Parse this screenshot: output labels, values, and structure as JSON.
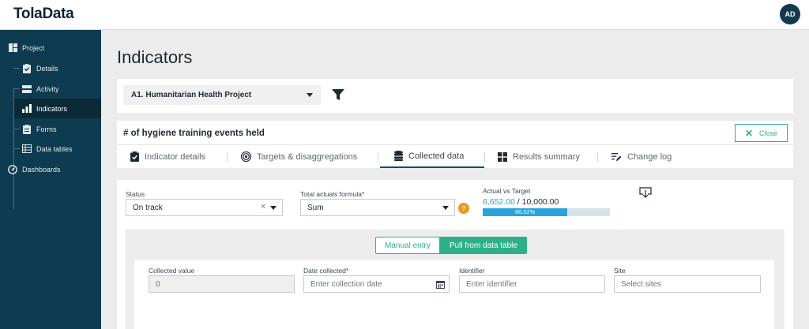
{
  "app": {
    "logo": "TolaData",
    "avatar_initials": "AD"
  },
  "sidebar": {
    "items": [
      {
        "label": "Project",
        "icon": "project-icon"
      },
      {
        "label": "Details",
        "icon": "clipboard-check-icon"
      },
      {
        "label": "Activity",
        "icon": "server-icon"
      },
      {
        "label": "Indicators",
        "icon": "bar-chart-icon",
        "active": true
      },
      {
        "label": "Forms",
        "icon": "clipboard-icon"
      },
      {
        "label": "Data tables",
        "icon": "table-icon"
      },
      {
        "label": "Dashboards",
        "icon": "gauge-icon"
      }
    ]
  },
  "page": {
    "title": "Indicators"
  },
  "project_select": {
    "value": "A1. Humanitarian Health Project",
    "filter_icon": "filter-icon"
  },
  "indicator": {
    "title": "# of hygiene training events held",
    "close_label": "Close",
    "tabs": [
      {
        "label": "Indicator details",
        "icon": "clipboard-check-icon"
      },
      {
        "label": "Targets & disaggregations",
        "icon": "target-icon"
      },
      {
        "label": "Collected data",
        "icon": "database-icon",
        "active": true
      },
      {
        "label": "Results summary",
        "icon": "grid-icon"
      },
      {
        "label": "Change log",
        "icon": "list-edit-icon"
      }
    ]
  },
  "collected": {
    "status_label": "Status",
    "status_value": "On track",
    "formula_label": "Total actuals formula*",
    "formula_value": "Sum",
    "help_glyph": "?",
    "avt_label": "Actual vs Target",
    "actual": "6,652.00",
    "target_text": " / 10,000.00",
    "progress_label": "66.52%",
    "progress_fraction": 0.6652,
    "toggle": {
      "manual": "Manual entry",
      "pull": "Pull from data table"
    },
    "fields": {
      "value_label": "Collected value",
      "value": "0",
      "date_label": "Date collected*",
      "date_placeholder": "Enter collection date",
      "identifier_label": "Identifier",
      "identifier_placeholder": "Enter identifier",
      "site_label": "Site",
      "site_placeholder": "Select sites"
    }
  },
  "colors": {
    "accent": "#2db089",
    "sidebar": "#0e3b4f",
    "progress": "#2aa3dc",
    "help": "#f0961a"
  }
}
